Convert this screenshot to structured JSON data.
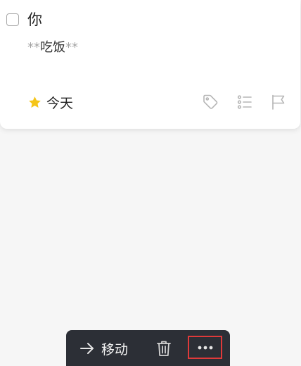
{
  "task": {
    "title": "你",
    "notes": {
      "prefix": "**",
      "text": "吃饭",
      "suffix": "**"
    },
    "when": {
      "label": "今天",
      "icon": "star-icon",
      "icon_color": "#f5c518"
    },
    "actions": [
      {
        "icon": "tag-icon"
      },
      {
        "icon": "checklist-icon"
      },
      {
        "icon": "flag-icon"
      }
    ]
  },
  "toolbar": {
    "move": {
      "label": "移动",
      "icon": "arrow-right-icon"
    },
    "delete": {
      "icon": "trash-icon"
    },
    "more": {
      "icon": "more-icon",
      "highlight_color": "#e03a3a"
    }
  },
  "colors": {
    "background": "#f6f6f6",
    "card": "#ffffff",
    "toolbar": "#2c2f36"
  }
}
